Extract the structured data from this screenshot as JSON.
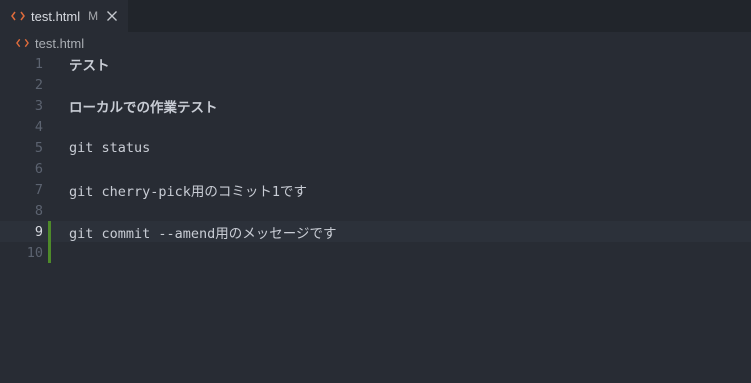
{
  "tab": {
    "file_icon": "html-code-icon",
    "title": "test.html",
    "modified_indicator": "M",
    "close_icon": "close-icon"
  },
  "breadcrumb": {
    "file_icon": "html-code-icon",
    "file": "test.html"
  },
  "editor": {
    "current_line": 9,
    "lines": [
      {
        "number": "1",
        "text": "テスト"
      },
      {
        "number": "2",
        "text": ""
      },
      {
        "number": "3",
        "text": "ローカルでの作業テスト"
      },
      {
        "number": "4",
        "text": ""
      },
      {
        "number": "5",
        "text": "git status"
      },
      {
        "number": "6",
        "text": ""
      },
      {
        "number": "7",
        "text": "git cherry-pick用のコミット1です"
      },
      {
        "number": "8",
        "text": ""
      },
      {
        "number": "9",
        "text": "git commit --amend用のメッセージです"
      },
      {
        "number": "10",
        "text": ""
      }
    ]
  },
  "colors": {
    "background": "#282c34",
    "tabbar": "#21252b",
    "html_icon": "#e06c3c",
    "added_marker": "#4e8a2a"
  }
}
